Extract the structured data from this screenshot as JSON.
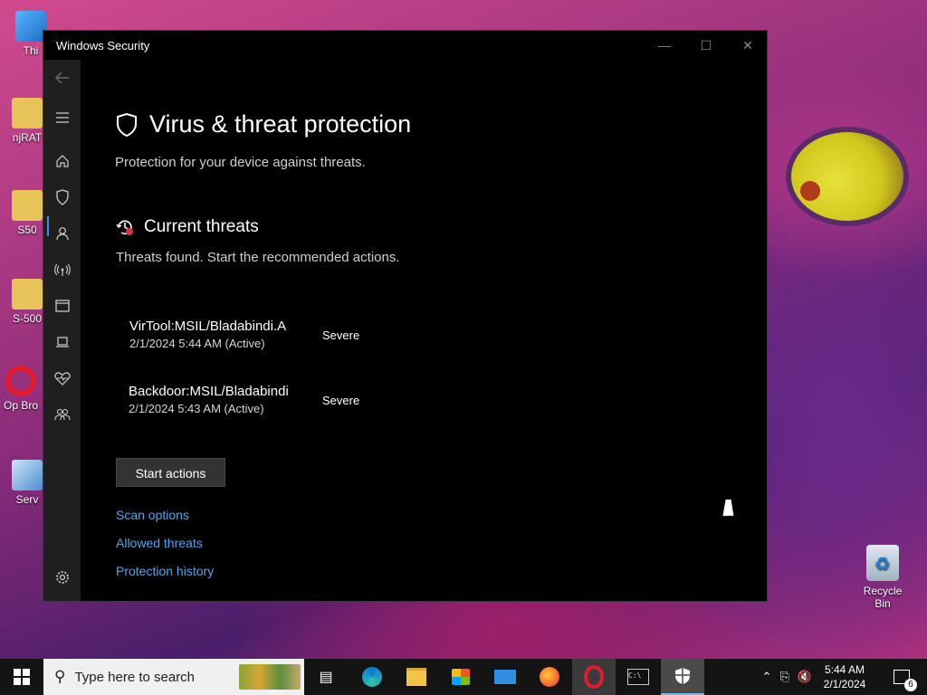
{
  "desktop": {
    "icons": [
      {
        "label": "Thi",
        "icon": "this-pc-icon"
      },
      {
        "label": "njRAT",
        "icon": "folder-icon"
      },
      {
        "label": "S50",
        "icon": "folder-icon"
      },
      {
        "label": "S-500",
        "icon": "folder-icon"
      },
      {
        "label": "Op Bro",
        "icon": "opera-browser-icon"
      },
      {
        "label": "Serv",
        "icon": "server-icon"
      }
    ],
    "recycle_bin": "Recycle Bin"
  },
  "window": {
    "title": "Windows Security",
    "controls": {
      "minimize": "—",
      "maximize": "☐",
      "close": "✕"
    }
  },
  "sidebar": {
    "items": [
      "back",
      "menu",
      "home",
      "virus-protection",
      "account",
      "network",
      "app-browser",
      "device-security",
      "device-health",
      "family",
      "settings"
    ]
  },
  "page": {
    "title": "Virus & threat protection",
    "subtitle": "Protection for your device against threats.",
    "section_title": "Current threats",
    "section_subtitle": "Threats found. Start the recommended actions.",
    "threats": [
      {
        "name": "VirTool:MSIL/Bladabindi.A",
        "time": "2/1/2024 5:44 AM (Active)",
        "severity": "Severe"
      },
      {
        "name": "Backdoor:MSIL/Bladabindi",
        "time": "2/1/2024 5:43 AM (Active)",
        "severity": "Severe"
      }
    ],
    "action_button": "Start actions",
    "links": [
      "Scan options",
      "Allowed threats",
      "Protection history"
    ]
  },
  "taskbar": {
    "search_placeholder": "Type here to search",
    "time": "5:44 AM",
    "date": "2/1/2024",
    "notification_count": "6",
    "accent": "#3c8ee6"
  }
}
